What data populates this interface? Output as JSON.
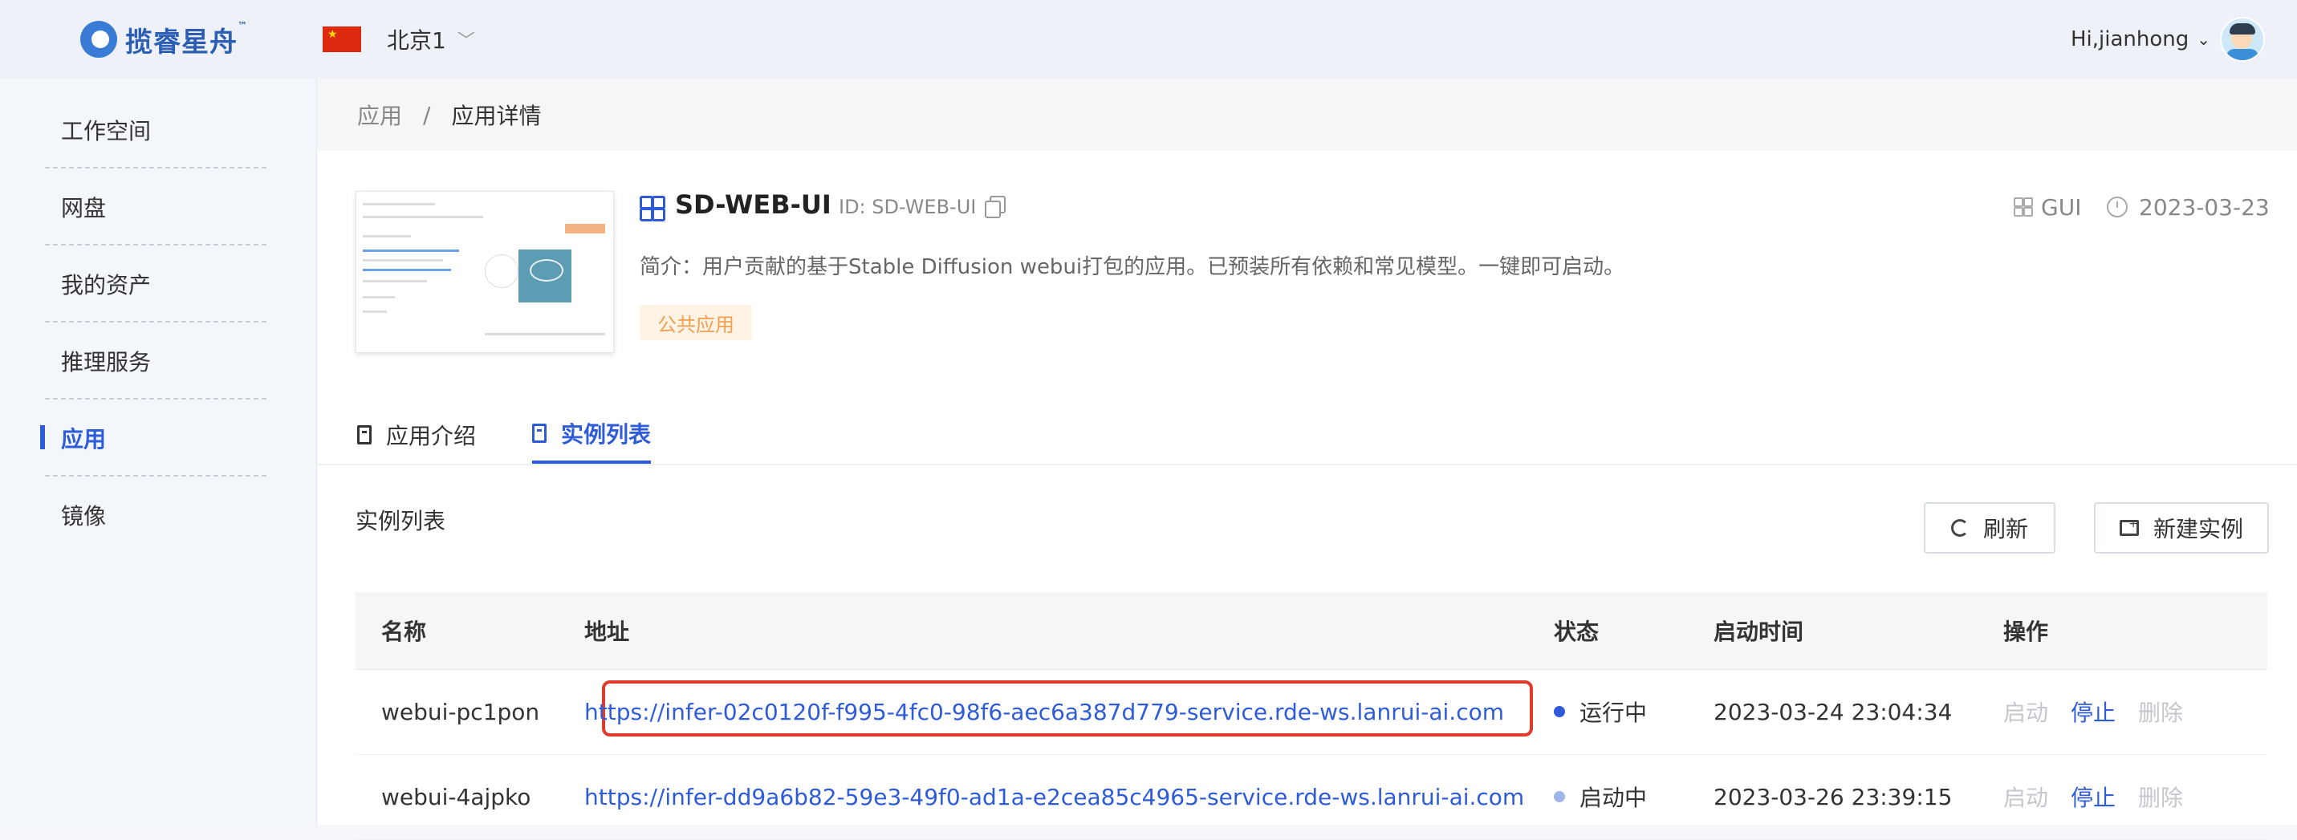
{
  "header": {
    "brand": "揽睿星舟",
    "brand_tm": "™",
    "region": "北京1",
    "user": "Hi,jianhong"
  },
  "sidebar": {
    "items": [
      {
        "label": "工作空间"
      },
      {
        "label": "网盘"
      },
      {
        "label": "我的资产"
      },
      {
        "label": "推理服务"
      },
      {
        "label": "应用"
      },
      {
        "label": "镜像"
      }
    ],
    "active_index": 4
  },
  "breadcrumb": {
    "root": "应用",
    "separator": "/",
    "current": "应用详情"
  },
  "app": {
    "name": "SD-WEB-UI",
    "id_text": "ID: SD-WEB-UI",
    "type": "GUI",
    "date": "2023-03-23",
    "description": "简介：用户贡献的基于Stable Diffusion webui打包的应用。已预装所有依赖和常见模型。一键即可启动。",
    "tag": "公共应用"
  },
  "tabs": [
    {
      "label": "应用介绍"
    },
    {
      "label": "实例列表"
    }
  ],
  "active_tab": 1,
  "instances": {
    "title": "实例列表",
    "refresh_label": "刷新",
    "new_label": "新建实例",
    "columns": [
      "名称",
      "地址",
      "状态",
      "启动时间",
      "操作"
    ],
    "rows": [
      {
        "name": "webui-pc1pon",
        "url": "https://infer-02c0120f-f995-4fc0-98f6-aec6a387d779-service.rde-ws.lanrui-ai.com",
        "status": "运行中",
        "status_color": "#2e5bd8",
        "start_time": "2023-03-24 23:04:34",
        "actions": {
          "start": "启动",
          "stop": "停止",
          "delete": "删除"
        }
      },
      {
        "name": "webui-4ajpko",
        "url": "https://infer-dd9a6b82-59e3-49f0-ad1a-e2cea85c4965-service.rde-ws.lanrui-ai.com",
        "status": "启动中",
        "status_color": "#9fb6e8",
        "start_time": "2023-03-26 23:39:15",
        "actions": {
          "start": "启动",
          "stop": "停止",
          "delete": "删除"
        }
      }
    ]
  },
  "colors": {
    "accent": "#2e5bd8",
    "highlight_box": "#e03a2c",
    "tag_text": "#f0a050"
  }
}
